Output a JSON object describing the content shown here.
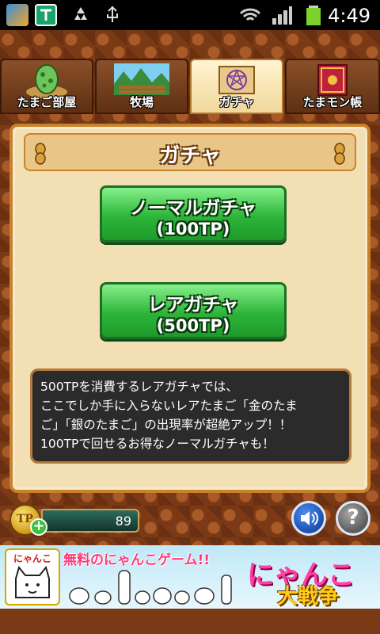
{
  "status_bar": {
    "time": "4:49"
  },
  "tabs": [
    {
      "label": "たまご部屋",
      "icon": "egg-icon"
    },
    {
      "label": "牧場",
      "icon": "ranch-icon"
    },
    {
      "label": "ガチャ",
      "icon": "scroll-icon",
      "active": true
    },
    {
      "label": "たまモン帳",
      "icon": "book-icon"
    }
  ],
  "panel": {
    "title": "ガチャ",
    "normal_gacha": {
      "line1": "ノーマルガチャ",
      "line2": "(100TP)"
    },
    "rare_gacha": {
      "line1": "レアガチャ",
      "line2": "(500TP)"
    },
    "description": [
      "500TPを消費するレアガチャでは、",
      "ここでしか手に入らないレアたまご「金のたま",
      "ご」「銀のたまご」の出現率が超絶アップ！！",
      "100TPで回せるお得なノーマルガチャも！"
    ]
  },
  "bottom": {
    "coin_label": "TP",
    "tp_value": "89",
    "plus": "+",
    "help": "?"
  },
  "banner": {
    "logo_text": "にゃんこ",
    "headline": "無料のにゃんこゲーム!!",
    "title1": "にゃんこ",
    "title2": "大戦争"
  },
  "colors": {
    "accent_green": "#2db53a",
    "panel_bg": "#f3dfb4",
    "border": "#c9822c"
  }
}
